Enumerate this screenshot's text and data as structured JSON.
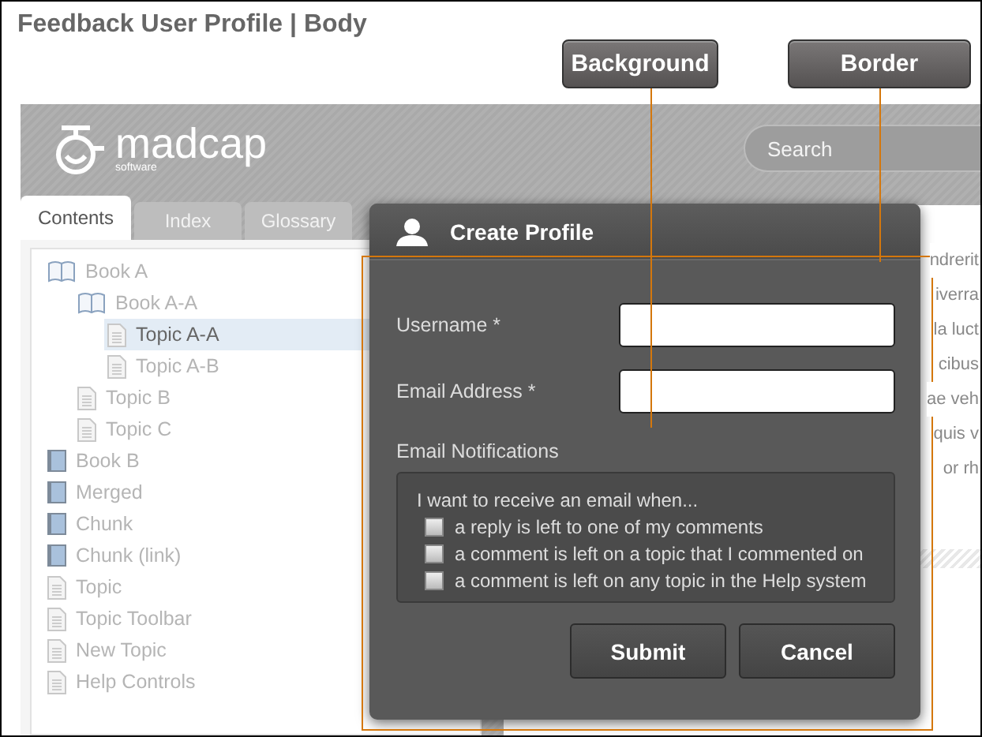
{
  "title": "Feedback User Profile | Body",
  "callouts": [
    {
      "label": "Background"
    },
    {
      "label": "Border"
    }
  ],
  "header": {
    "logo": "madcap",
    "logo_sub": "software",
    "search": {
      "placeholder": "Search"
    }
  },
  "tabs": [
    {
      "label": "Contents",
      "selected": true
    },
    {
      "label": "Index",
      "selected": false
    },
    {
      "label": "Glossary",
      "selected": false
    }
  ],
  "tree": [
    {
      "label": "Book A",
      "kind": "book-open",
      "selected": false,
      "children": [
        {
          "label": "Book A-A",
          "kind": "book-open",
          "selected": false,
          "children": [
            {
              "label": "Topic A-A",
              "kind": "topic",
              "selected": true
            },
            {
              "label": "Topic A-B",
              "kind": "topic",
              "selected": false
            }
          ]
        },
        {
          "label": "Topic B",
          "kind": "topic",
          "selected": false
        },
        {
          "label": "Topic C",
          "kind": "topic",
          "selected": false
        }
      ]
    },
    {
      "label": "Book B",
      "kind": "book",
      "selected": false
    },
    {
      "label": "Merged",
      "kind": "book",
      "selected": false
    },
    {
      "label": "Chunk",
      "kind": "book",
      "selected": false
    },
    {
      "label": "Chunk (link)",
      "kind": "book",
      "selected": false
    },
    {
      "label": "Topic",
      "kind": "topic",
      "selected": false
    },
    {
      "label": "Topic Toolbar",
      "kind": "topic",
      "selected": false
    },
    {
      "label": "New Topic",
      "kind": "topic",
      "selected": false
    },
    {
      "label": "Help Controls",
      "kind": "topic",
      "selected": false
    }
  ],
  "content_lines": [
    "ndrerit",
    "iverra",
    "la luct",
    "cibus",
    "ae veh",
    "quis v",
    "or rh"
  ],
  "dialog": {
    "title": "Create Profile",
    "fields": [
      {
        "label": "Username *"
      },
      {
        "label": "Email Address *"
      }
    ],
    "notifications": {
      "label": "Email Notifications",
      "intro": "I want to receive an email when...",
      "options": [
        {
          "label": "a reply is left to one of my comments",
          "checked": false
        },
        {
          "label": "a comment is left on a topic that I commented on",
          "checked": false
        },
        {
          "label": "a comment is left on any topic in the Help system",
          "checked": false
        }
      ]
    },
    "buttons": [
      "Submit",
      "Cancel"
    ]
  }
}
